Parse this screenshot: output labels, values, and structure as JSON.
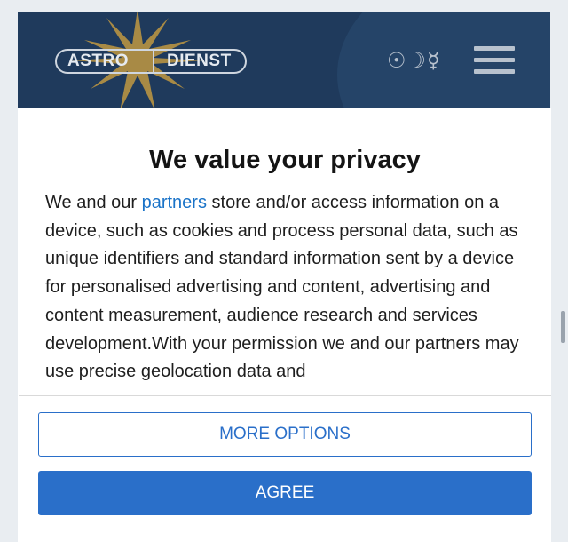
{
  "header": {
    "logo_word_1": "ASTRO",
    "logo_word_2": "DIENST",
    "planet_symbols": "☉☽☿",
    "colors": {
      "background": "#1f3a5c",
      "star": "#a88a45"
    }
  },
  "dialog": {
    "title": "We value your privacy",
    "body_before_link": "We and our ",
    "link_text": "partners",
    "body_after_link": " store and/or access information on a device, such as cookies and process personal data, such as unique identifiers and standard information sent by a device for personalised advertising and content, advertising and content measurement, audience research and services development.With your permission we and our partners may use precise geolocation data and",
    "more_options_label": "MORE OPTIONS",
    "agree_label": "AGREE",
    "colors": {
      "accent": "#2a6fc9",
      "link": "#1a73c8"
    }
  }
}
